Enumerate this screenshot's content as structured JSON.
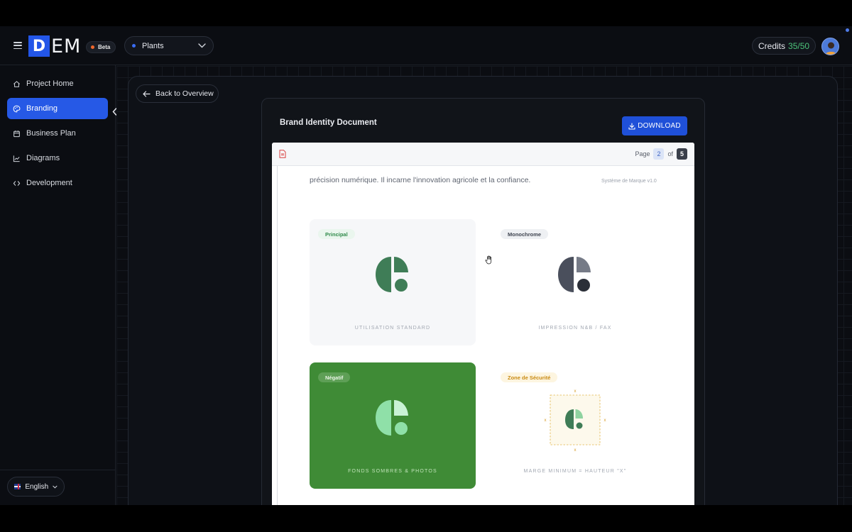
{
  "app": {
    "logo_initial": "D",
    "logo_text": "EM",
    "beta_label": "Beta",
    "project_name": "Plants",
    "credits_label": "Credits",
    "credits_value": "35/50",
    "accent_color": "#2659e6"
  },
  "sidebar": {
    "items": [
      {
        "label": "Project Home",
        "icon": "home-icon"
      },
      {
        "label": "Branding",
        "icon": "palette-icon",
        "active": true
      },
      {
        "label": "Business Plan",
        "icon": "calendar-icon"
      },
      {
        "label": "Diagrams",
        "icon": "chart-line-icon"
      },
      {
        "label": "Development",
        "icon": "code-icon"
      }
    ],
    "language": "English"
  },
  "main": {
    "back_label": "Back to Overview",
    "doc_title": "Brand Identity Document",
    "download_label": "DOWNLOAD",
    "pager": {
      "page_label": "Page",
      "current": "2",
      "of_label": "of",
      "total": "5"
    },
    "intro_text": "précision numérique. Il incarne l'innovation agricole et la confiance.",
    "system_version": "Système de Marque v1.0",
    "tiles": [
      {
        "tag": "Principal",
        "label": "UTILISATION STANDARD",
        "mark_color": "#3f7d57",
        "tag_color": "#2f8a4a",
        "tag_bg": "#eaf6ee"
      },
      {
        "tag": "Monochrome",
        "label": "IMPRESSION N&B / FAX",
        "mark_color": "#4a4f5c",
        "tag_color": "#3f4450",
        "tag_bg": "#eef0f3"
      },
      {
        "tag": "Négatif",
        "label": "FONDS SOMBRES & PHOTOS",
        "mark_color": "#8fe0a8",
        "tile_bg": "#3f8b36"
      },
      {
        "tag": "Zone de Sécurité",
        "label": "MARGE MINIMUM = HAUTEUR \"X\"",
        "mark_color": "#3f7d57",
        "tag_color": "#c98a12",
        "tag_bg": "#fdf5e0",
        "margin_marker": "x"
      }
    ]
  }
}
